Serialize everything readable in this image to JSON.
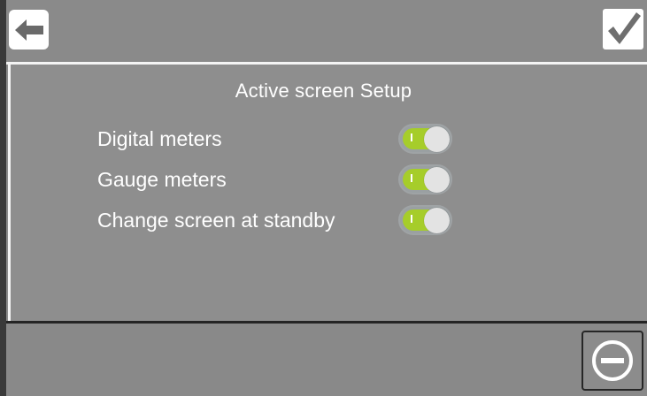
{
  "header": {
    "back_icon": "arrow-left-icon",
    "confirm_icon": "checkmark-icon"
  },
  "main": {
    "title": "Active screen Setup",
    "settings": [
      {
        "label": "Digital meters",
        "toggle_state": "on"
      },
      {
        "label": "Gauge meters",
        "toggle_state": "on"
      },
      {
        "label": "Change screen at standby",
        "toggle_state": "on"
      }
    ]
  },
  "footer": {
    "cancel_icon": "minus-circle-icon"
  },
  "colors": {
    "background": "#8b8b8b",
    "toggle_on": "#a6cd2a",
    "toggle_knob": "#e3e3e3",
    "divider_light": "#f4f4f4",
    "divider_dark": "#242424",
    "text": "#ffffff"
  }
}
